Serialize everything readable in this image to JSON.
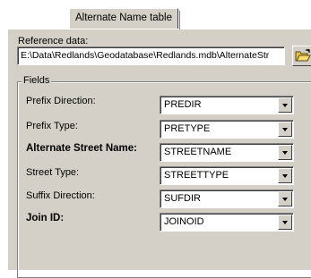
{
  "tab": {
    "label": "Alternate Name table"
  },
  "reference": {
    "label": "Reference data:",
    "value": "E:\\Data\\Redlands\\Geodatabase\\Redlands.mdb\\AlternateStr",
    "browse_icon": "folder-open-icon"
  },
  "fields": {
    "group_label": "Fields",
    "rows": [
      {
        "label": "Prefix Direction:",
        "value": "PREDIR",
        "bold": false
      },
      {
        "label": "Prefix Type:",
        "value": "PRETYPE",
        "bold": false
      },
      {
        "label": "Alternate Street Name:",
        "value": "STREETNAME",
        "bold": true
      },
      {
        "label": "Street Type:",
        "value": "STREETTYPE",
        "bold": false
      },
      {
        "label": "Suffix Direction:",
        "value": "SUFDIR",
        "bold": false
      },
      {
        "label": "Join ID:",
        "value": "JOINOID",
        "bold": true
      }
    ]
  },
  "colors": {
    "face": "#d4d0c8",
    "shadow": "#808080",
    "highlight": "#ffffff"
  }
}
